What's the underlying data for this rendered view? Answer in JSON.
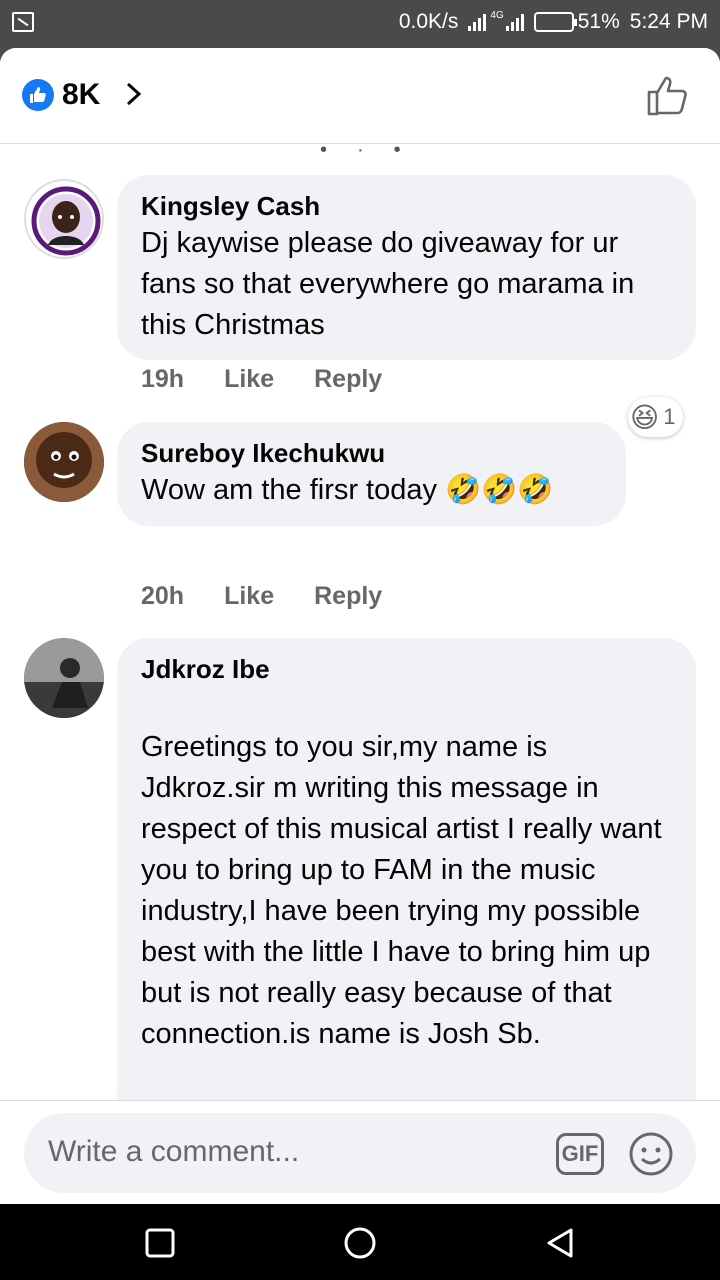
{
  "status": {
    "net_speed": "0.0K/s",
    "network_type": "4G",
    "battery": "51%",
    "battery_level": 0.51,
    "time": "5:24 PM"
  },
  "header": {
    "reaction_count": "8K",
    "like_color": "#1877f2"
  },
  "comments": [
    {
      "author": "Kingsley Cash",
      "text": "Dj kaywise please do giveaway for ur fans so that everywhere go marama in this Christmas",
      "time": "19h",
      "like_label": "Like",
      "reply_label": "Reply",
      "reaction_emoji": "😆",
      "reaction_count": "1"
    },
    {
      "author": "Sureboy Ikechukwu",
      "text": "Wow am the firsr today 🤣🤣🤣",
      "time": "20h",
      "like_label": "Like",
      "reply_label": "Reply"
    },
    {
      "author": "Jdkroz Ibe",
      "text": "\nGreetings to you sir,my name is Jdkroz.sir m writing this message in respect of this musical artist I really want  you to bring up to FAM in the music industry,I have been trying my possible best with the little I have to bring him up but is not really easy because of that connection.is name is Josh Sb."
    }
  ],
  "composer": {
    "placeholder": "Write a comment...",
    "gif_label": "GIF"
  }
}
